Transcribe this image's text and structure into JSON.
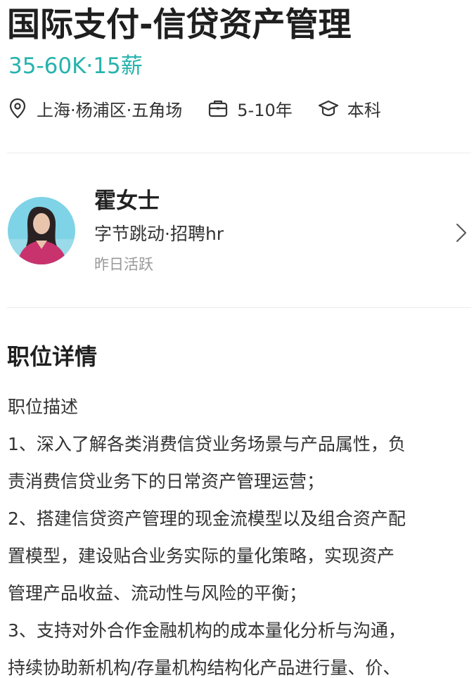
{
  "job": {
    "title": "国际支付-信贷资产管理",
    "salary": "35-60K·15薪",
    "location": "上海·杨浦区·五角场",
    "experience": "5-10年",
    "education": "本科"
  },
  "icons": {
    "location": "location-pin-icon",
    "experience": "briefcase-icon",
    "education": "graduation-cap-icon",
    "chevron": "chevron-right-icon"
  },
  "colors": {
    "salary": "#27b3ad",
    "title": "#1f1f1f",
    "muted": "#999999",
    "divider": "#ececec"
  },
  "recruiter": {
    "name": "霍女士",
    "company_role": "字节跳动·招聘hr",
    "status": "昨日活跃"
  },
  "details": {
    "section_title": "职位详情",
    "lines": [
      "职位描述",
      "1、深入了解各类消费信贷业务场景与产品属性，负",
      "责消费信贷业务下的日常资产管理运营；",
      "2、搭建信贷资产管理的现金流模型以及组合资产配",
      "置模型，建设贴合业务实际的量化策略，实现资产",
      "管理产品收益、流动性与风险的平衡；",
      "3、支持对外合作金融机构的成本量化分析与沟通，",
      "持续协助新机构/存量机构结构化产品进行量、价、"
    ]
  }
}
